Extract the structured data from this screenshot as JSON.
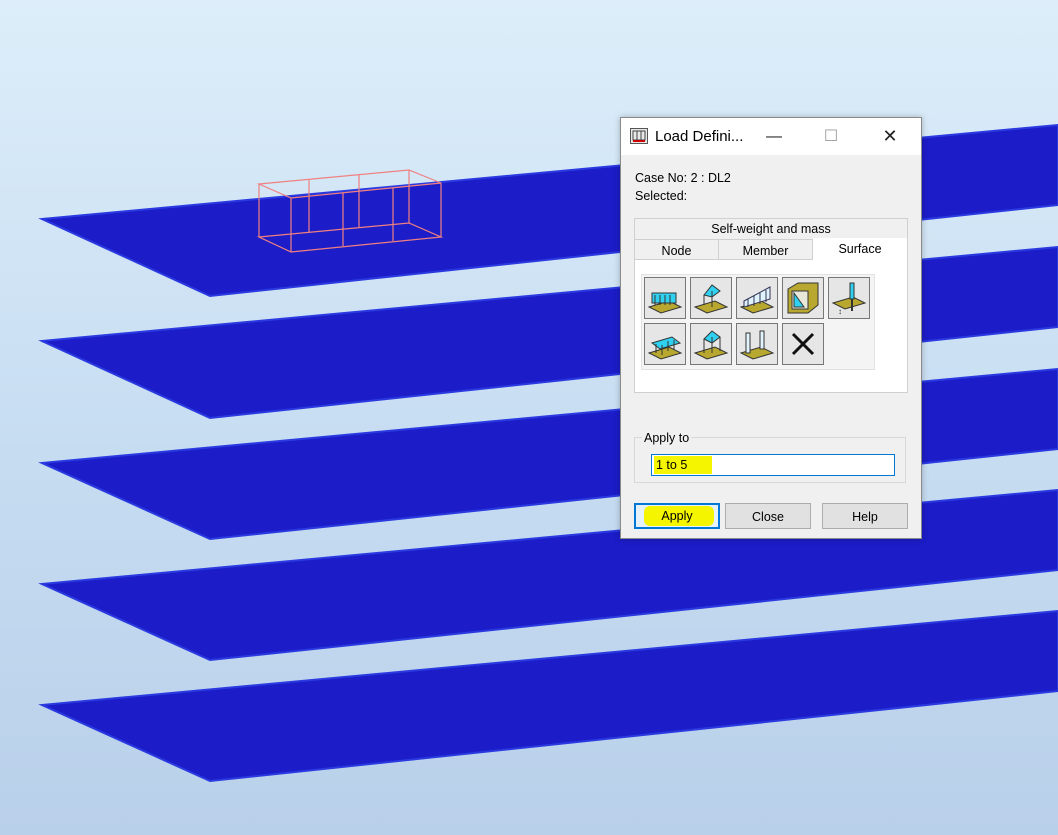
{
  "dialog": {
    "title": "Load Defini...",
    "case_line": "Case No: 2 : DL2",
    "selected_line": "Selected:",
    "window_controls": {
      "minimize": "—",
      "maximize": "☐",
      "close": "✕"
    },
    "tabs": {
      "self_weight": "Self-weight and mass",
      "node": "Node",
      "member": "Member",
      "surface": "Surface",
      "active": "Surface"
    },
    "surface_tools": [
      "uniform-surface-load-icon",
      "point-surface-load-icon",
      "linear-surface-load-icon",
      "hydrostatic-load-icon",
      "surface-edge-load-icon",
      "planar-load-icon",
      "surface-load-point-icon",
      "edge-line-load-icon",
      "delete-load-icon"
    ],
    "apply_to": {
      "label": "Apply to",
      "value": "1 to 5"
    },
    "buttons": {
      "apply": "Apply",
      "close": "Close",
      "help": "Help"
    },
    "highlight_color": "#f5f500"
  },
  "scene": {
    "plate_color": "#1c1cc8",
    "plate_count": 5,
    "frame_color": "#f08080"
  }
}
